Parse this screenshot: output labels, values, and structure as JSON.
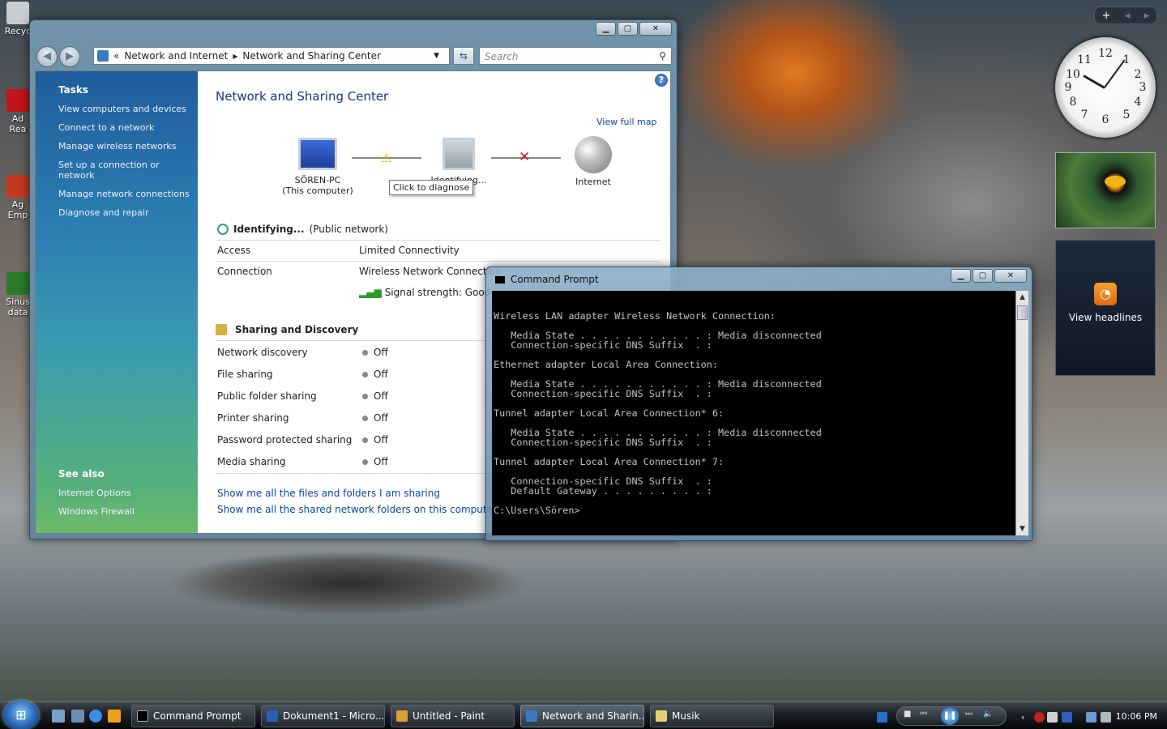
{
  "desktop": {
    "icons": [
      {
        "label": "Recyc",
        "color": "#c9cdd2"
      },
      {
        "label": "Ad Rea",
        "color": "#c2141b"
      },
      {
        "label": "Ag Emp",
        "color": "#c23b1d"
      },
      {
        "label": "Sinus data",
        "color": "#2a7a2a"
      }
    ]
  },
  "nsc": {
    "address": {
      "root_glyph": "«",
      "crumbs": [
        "Network and Internet",
        "Network and Sharing Center"
      ],
      "separator": "▸"
    },
    "search_placeholder": "Search",
    "tasks": {
      "title": "Tasks",
      "links": [
        "View computers and devices",
        "Connect to a network",
        "Manage wireless networks",
        "Set up a connection or network",
        "Manage network connections",
        "Diagnose and repair"
      ]
    },
    "see_also": {
      "title": "See also",
      "links": [
        "Internet Options",
        "Windows Firewall"
      ]
    },
    "title": "Network and Sharing Center",
    "view_full_map": "View full map",
    "map": {
      "computer": "SÖREN-PC",
      "computer_sub": "(This computer)",
      "middle": "Identifying...",
      "internet": "Internet",
      "tooltip": "Click to diagnose"
    },
    "network": {
      "name": "Identifying...",
      "type": "(Public network)",
      "rows": [
        {
          "key": "Access",
          "value": "Limited Connectivity"
        },
        {
          "key": "Connection",
          "value": "Wireless Network Connection"
        }
      ],
      "signal": "Signal strength:  Good"
    },
    "sharing": {
      "title": "Sharing and Discovery",
      "rows": [
        {
          "key": "Network discovery",
          "value": "Off"
        },
        {
          "key": "File sharing",
          "value": "Off"
        },
        {
          "key": "Public folder sharing",
          "value": "Off"
        },
        {
          "key": "Printer sharing",
          "value": "Off"
        },
        {
          "key": "Password protected sharing",
          "value": "Off"
        },
        {
          "key": "Media sharing",
          "value": "Off"
        }
      ]
    },
    "bottom_links": [
      "Show me all the files and folders I am sharing",
      "Show me all the shared network folders on this computer"
    ]
  },
  "cmd": {
    "title": "Command Prompt",
    "output": "Wireless LAN adapter Wireless Network Connection:\n\n   Media State . . . . . . . . . . . : Media disconnected\n   Connection-specific DNS Suffix  . :\n\nEthernet adapter Local Area Connection:\n\n   Media State . . . . . . . . . . . : Media disconnected\n   Connection-specific DNS Suffix  . :\n\nTunnel adapter Local Area Connection* 6:\n\n   Media State . . . . . . . . . . . : Media disconnected\n   Connection-specific DNS Suffix  . :\n\nTunnel adapter Local Area Connection* 7:\n\n   Connection-specific DNS Suffix  . :\n   Default Gateway . . . . . . . . . :\n\nC:\\Users\\Sören>"
  },
  "gadgets": {
    "sidebar_buttons": [
      "+",
      "◂",
      "▸"
    ],
    "clock_numbers": [
      "12",
      "1",
      "2",
      "3",
      "4",
      "5",
      "6",
      "7",
      "8",
      "9",
      "10",
      "11"
    ],
    "feeds_label": "View headlines"
  },
  "taskbar": {
    "buttons": [
      {
        "label": "Command Prompt",
        "icon_color": "#000"
      },
      {
        "label": "Dokument1 - Micro...",
        "icon_color": "#2a5fb8"
      },
      {
        "label": "Untitled - Paint",
        "icon_color": "#d8a030"
      },
      {
        "label": "Network and Sharin...",
        "icon_color": "#3a7abf"
      },
      {
        "label": "Musik",
        "icon_color": "#e8d070"
      }
    ],
    "time": "10:06 PM"
  }
}
